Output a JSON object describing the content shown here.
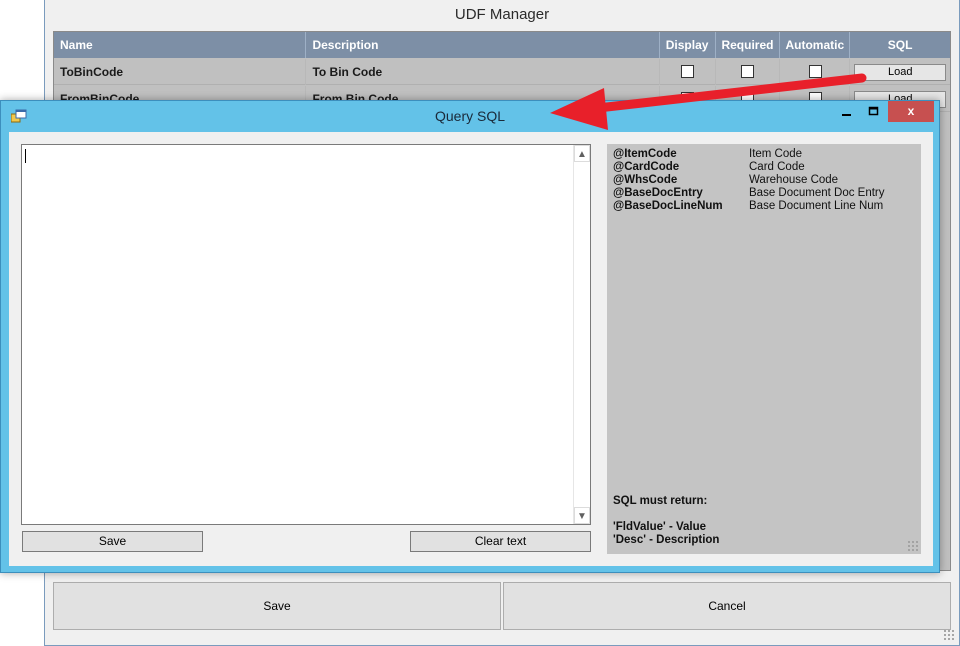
{
  "udf_manager": {
    "title": "UDF Manager",
    "columns": [
      "Name",
      "Description",
      "Display",
      "Required",
      "Automatic",
      "SQL"
    ],
    "rows": [
      {
        "name": "ToBinCode",
        "description": "To Bin Code",
        "load_label": "Load"
      },
      {
        "name": "FromBinCode",
        "description": "From Bin Code",
        "load_label": "Load"
      }
    ],
    "save_label": "Save",
    "cancel_label": "Cancel"
  },
  "query_sql": {
    "title": "Query SQL",
    "window_buttons": {
      "minimize": "minimize-icon",
      "maximize": "maximize-icon",
      "close_glyph": "x"
    },
    "sql_text_value": "",
    "save_label": "Save",
    "clear_label": "Clear text",
    "parameters": [
      {
        "param": "@ItemCode",
        "desc": "Item Code"
      },
      {
        "param": "@CardCode",
        "desc": "Card Code"
      },
      {
        "param": "@WhsCode",
        "desc": "Warehouse Code"
      },
      {
        "param": "@BaseDocEntry",
        "desc": "Base Document Doc Entry"
      },
      {
        "param": "@BaseDocLineNum",
        "desc": "Base Document Line Num"
      }
    ],
    "must_return_label": "SQL must return:",
    "return_fields": [
      "'FldValue' - Value",
      "'Desc' - Description"
    ]
  },
  "colors": {
    "dialog_frame": "#63c2e8",
    "grid_header": "#7d8fa6",
    "close_button": "#c75050",
    "annotation_arrow": "#e8202a"
  }
}
